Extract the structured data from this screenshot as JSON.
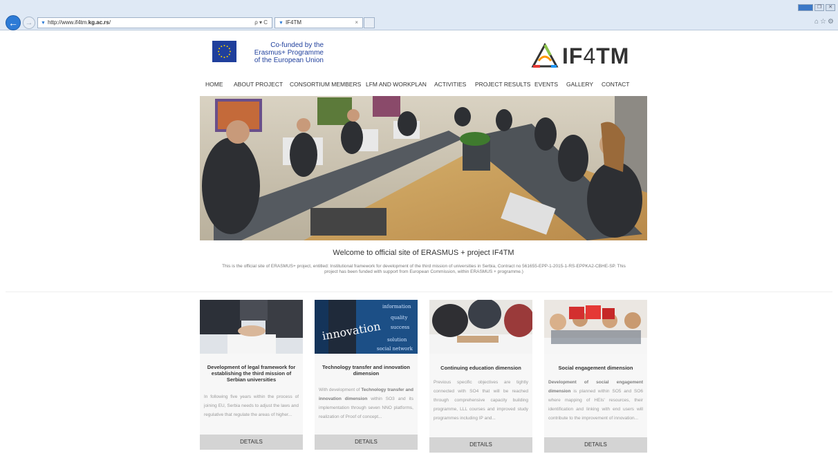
{
  "browser": {
    "url_prefix": "http://www.if4tm.",
    "url_bold": "kg.ac.rs",
    "url_suffix": "/",
    "addr_tools": "ρ ▾ C",
    "tab_title": "IF4TM",
    "tab_close": "×",
    "win_buttons": [
      "",
      "❐",
      "✕"
    ],
    "right_icons": "⌂☆⚙"
  },
  "header": {
    "eu_lines": [
      "Co-funded by the",
      "Erasmus+ Programme",
      "of the European Union"
    ],
    "brand_bold": "IF",
    "brand_thin": "4",
    "brand_bold2": "TM"
  },
  "nav": {
    "items": [
      "HOME",
      "ABOUT PROJECT",
      "CONSORTIUM MEMBERS",
      "LFM AND WORKPLAN",
      "ACTIVITIES",
      "PROJECT RESULTS",
      "EVENTS",
      "GALLERY",
      "CONTACT"
    ]
  },
  "main": {
    "welcome": "Welcome to official site of ERASMUS + project IF4TM",
    "description": "This is the official site of ERASMUS+ project, entitled: Institutional framework for development of the third mission of universities in Serbia, Contract no 561655-EPP-1-2015-1-RS-EPPKA2-CBHE-SP. This project has been funded with support from European Commission, within ERASMUS + programme.)"
  },
  "cards": [
    {
      "title": "Development of legal framework for establishing the third mission of Serbian universities",
      "text": "In following five years within the process of joining EU, Serbia needs to adjust the laws and regulative that regulate the areas of higher...",
      "button": "DETAILS"
    },
    {
      "title": "Technology transfer and innovation dimension",
      "text_pre": "With development of ",
      "text_bold": "Technology transfer and innovation dimension",
      "text_post": " within SO3 and its implementation through seven NNO platforms, realization of Proof of concept...",
      "image_words": [
        "innovation",
        "information",
        "quality",
        "success",
        "solution",
        "social network"
      ],
      "button": "DETAILS"
    },
    {
      "title": "Continuing education dimension",
      "text": "Previous specific objectives are tightly connected with SO4 that will be reached through comprehensive capacity building programme, LLL courses and improved study programmes including IP and...",
      "button": "DETAILS"
    },
    {
      "title": "Social engagement dimension",
      "text_bold": "Development of social engagement dimension",
      "text_post": " is planned within SO5 and SO6 where mapping of HEIs' resources, their identification and linking with end users will contribute to the improvement of innovation...",
      "button": "DETAILS"
    }
  ]
}
